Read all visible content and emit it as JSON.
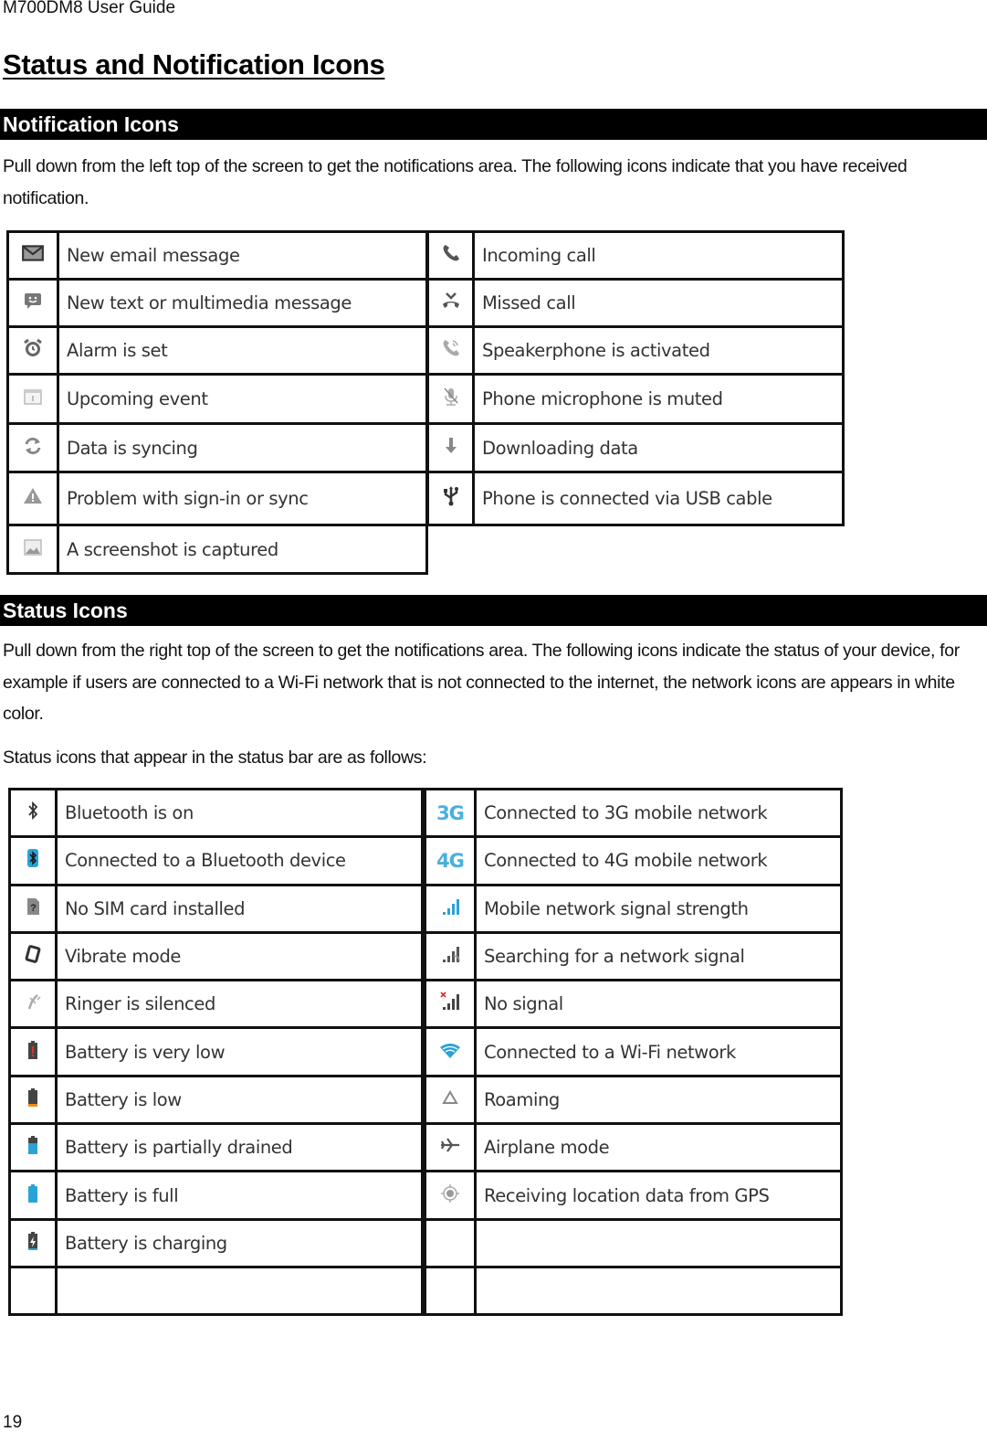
{
  "document": {
    "header": "M700DM8 User Guide",
    "page_title": "Status and Notification Icons",
    "page_number": "19"
  },
  "notification_section": {
    "heading": "Notification Icons",
    "description": "Pull down from the left top of the screen to get the notifications area. The following icons indicate that you have received notification.",
    "left_column": [
      {
        "icon": "email-icon",
        "label": "New email message"
      },
      {
        "icon": "text-message-icon",
        "label": "New text or multimedia message"
      },
      {
        "icon": "alarm-icon",
        "label": "Alarm is set"
      },
      {
        "icon": "calendar-event-icon",
        "label": "Upcoming event"
      },
      {
        "icon": "sync-icon",
        "label": "Data is syncing"
      },
      {
        "icon": "warning-icon",
        "label": "Problem with sign-in or sync"
      },
      {
        "icon": "screenshot-icon",
        "label": "A screenshot is captured"
      }
    ],
    "right_column": [
      {
        "icon": "incoming-call-icon",
        "label": "Incoming call"
      },
      {
        "icon": "missed-call-icon",
        "label": "Missed call"
      },
      {
        "icon": "speakerphone-icon",
        "label": "Speakerphone is activated"
      },
      {
        "icon": "mic-muted-icon",
        "label": "Phone microphone is muted"
      },
      {
        "icon": "download-icon",
        "label": "Downloading data"
      },
      {
        "icon": "usb-icon",
        "label": "Phone is connected via USB cable"
      }
    ]
  },
  "status_section": {
    "heading": "Status Icons",
    "description": "Pull down from the right top of the screen to get the notifications area. The following icons indicate the status of your device, for example if users are connected to a Wi-Fi network that is not connected to the internet, the network icons are appears in white color.",
    "intro": "Status icons that appear in the status bar are as follows:",
    "left_column": [
      {
        "icon": "bluetooth-icon",
        "label": "Bluetooth is on"
      },
      {
        "icon": "bluetooth-connected-icon",
        "label": "Connected to a Bluetooth device"
      },
      {
        "icon": "no-sim-icon",
        "label": "No SIM card installed"
      },
      {
        "icon": "vibrate-icon",
        "label": "Vibrate mode"
      },
      {
        "icon": "ringer-silenced-icon",
        "label": "Ringer is silenced"
      },
      {
        "icon": "battery-very-low-icon",
        "label": "Battery is very low"
      },
      {
        "icon": "battery-low-icon",
        "label": "Battery is low"
      },
      {
        "icon": "battery-partial-icon",
        "label": "Battery is partially drained"
      },
      {
        "icon": "battery-full-icon",
        "label": "Battery is full"
      },
      {
        "icon": "battery-charging-icon",
        "label": "Battery is charging"
      },
      {
        "icon": "",
        "label": ""
      }
    ],
    "right_column": [
      {
        "icon": "3g-icon",
        "icon_text": "3G",
        "label": "Connected to 3G mobile network"
      },
      {
        "icon": "4g-icon",
        "icon_text": "4G",
        "label": "Connected to 4G mobile network"
      },
      {
        "icon": "signal-strength-icon",
        "label": "Mobile network signal strength"
      },
      {
        "icon": "signal-searching-icon",
        "label": "Searching for a network signal"
      },
      {
        "icon": "no-signal-icon",
        "label": "No signal"
      },
      {
        "icon": "wifi-icon",
        "label": "Connected to a Wi-Fi network"
      },
      {
        "icon": "roaming-icon",
        "label": "Roaming"
      },
      {
        "icon": "airplane-icon",
        "label": "Airplane mode"
      },
      {
        "icon": "gps-icon",
        "label": "Receiving location data from GPS"
      },
      {
        "icon": "",
        "label": ""
      },
      {
        "icon": "",
        "label": ""
      }
    ]
  },
  "colors": {
    "accent_blue": "#2aa3d6",
    "battery_red": "#d8352a",
    "battery_orange": "#f08a1c",
    "icon_gray": "#6b6b6b"
  }
}
